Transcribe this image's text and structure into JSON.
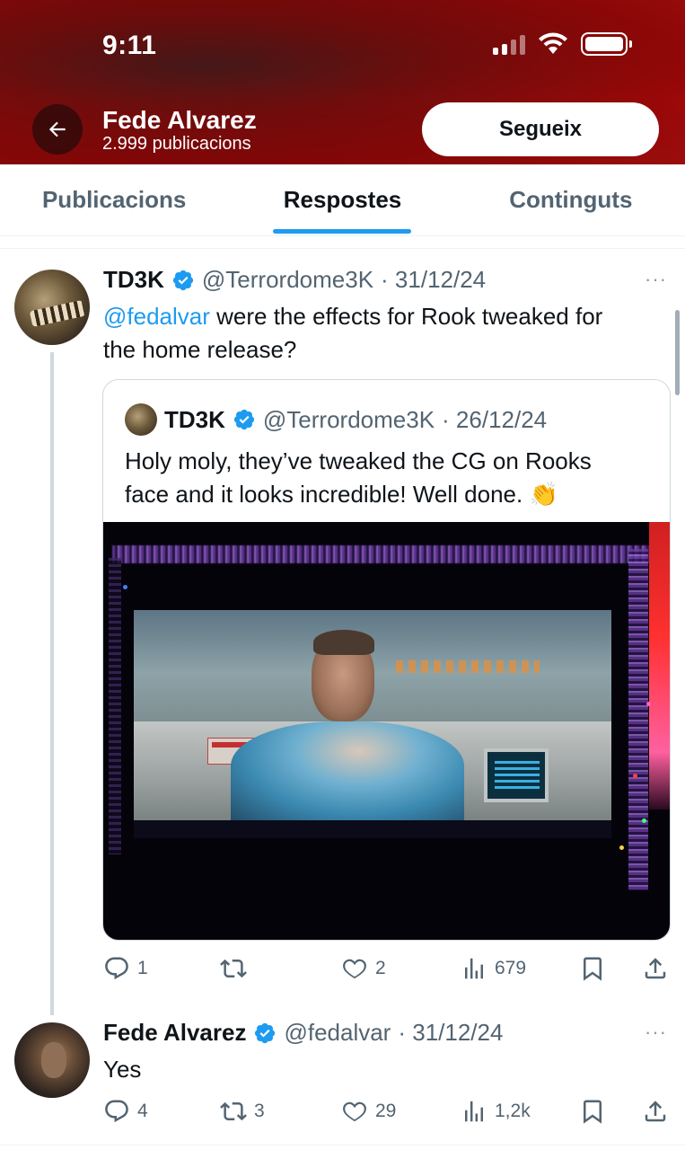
{
  "status_bar": {
    "time": "9:11"
  },
  "header": {
    "profile_name": "Fede Alvarez",
    "post_count": "2.999 publicacions",
    "follow_label": "Segueix"
  },
  "tabs": [
    {
      "label": "Publicacions",
      "active": false
    },
    {
      "label": "Respostes",
      "active": true
    },
    {
      "label": "Continguts",
      "active": false
    }
  ],
  "tweets": [
    {
      "name": "TD3K",
      "handle": "@Terrordome3K",
      "date": "· 31/12/24",
      "mention": "@fedalvar",
      "text_line1": " were the effects for Rook tweaked for",
      "text_line2": "the home release?",
      "quote": {
        "name": "TD3K",
        "handle": "@Terrordome3K",
        "date": "· 26/12/24",
        "text_line1": "Holy moly, they’ve tweaked the CG on Rooks",
        "text_line2": "face and it looks incredible! Well done. 👏"
      },
      "stats": {
        "replies": "1",
        "reposts": "",
        "likes": "2",
        "views": "679"
      }
    },
    {
      "name": "Fede Alvarez",
      "handle": "@fedalvar",
      "date": "· 31/12/24",
      "text": "Yes",
      "stats": {
        "replies": "4",
        "reposts": "3",
        "likes": "29",
        "views": "1,2k"
      }
    }
  ],
  "colors": {
    "accent": "#1d9bf0",
    "header_red": "#a00808",
    "secondary_text": "#536471",
    "primary_text": "#0f1419"
  },
  "more_label": "···"
}
